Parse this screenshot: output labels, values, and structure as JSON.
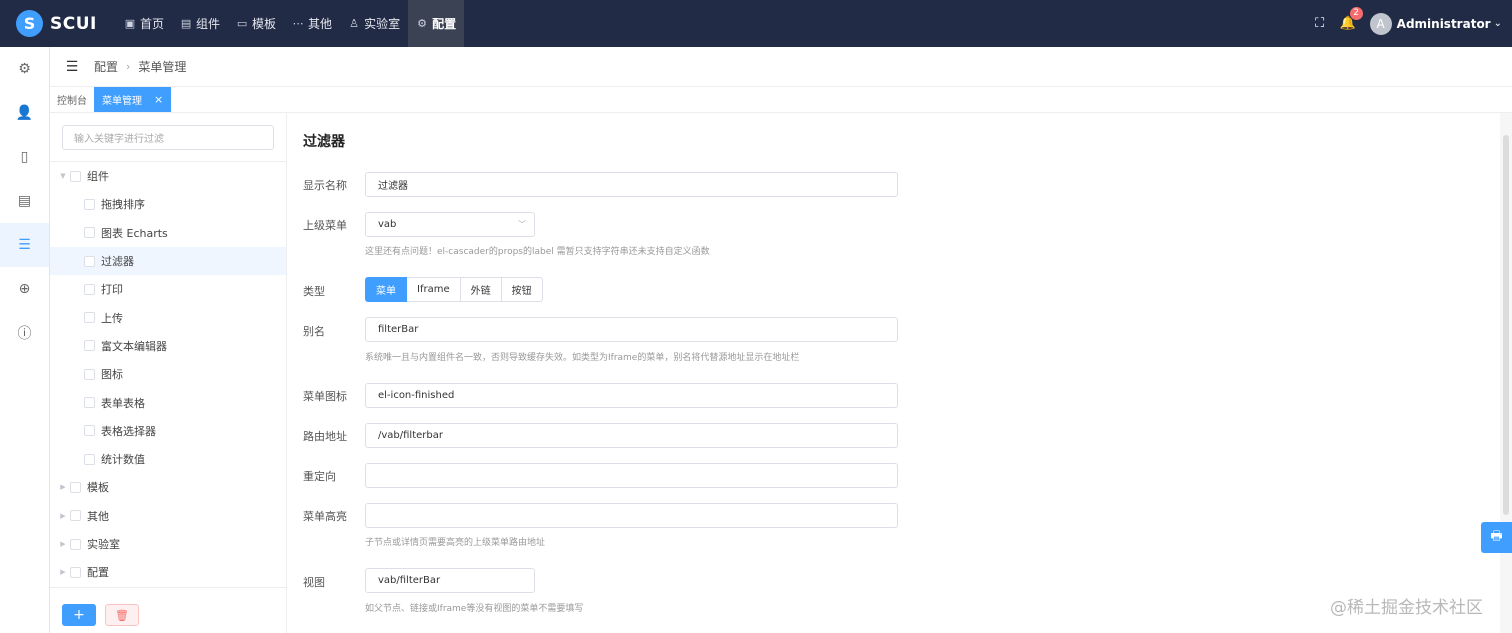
{
  "brand": {
    "name": "SCUI",
    "mark": "S"
  },
  "topnav": [
    {
      "label": "首页",
      "icon": "home-icon",
      "glyph": "▣"
    },
    {
      "label": "组件",
      "icon": "component-icon",
      "glyph": "▤"
    },
    {
      "label": "模板",
      "icon": "template-icon",
      "glyph": "▭"
    },
    {
      "label": "其他",
      "icon": "more-icon",
      "glyph": "⋯"
    },
    {
      "label": "实验室",
      "icon": "lab-icon",
      "glyph": "♙"
    },
    {
      "label": "配置",
      "icon": "settings-icon",
      "glyph": "⚙",
      "active": true
    }
  ],
  "user": {
    "avatar": "A",
    "name": "Administrator",
    "notifications": "2"
  },
  "rail": [
    {
      "icon": "gear-icon",
      "glyph": "⚙"
    },
    {
      "icon": "user-icon",
      "glyph": "👤"
    },
    {
      "icon": "book-icon",
      "glyph": "▯"
    },
    {
      "icon": "document-icon",
      "glyph": "▤"
    },
    {
      "icon": "menu-icon",
      "glyph": "☰",
      "active": true
    },
    {
      "icon": "circle-plus-icon",
      "glyph": "⊕"
    },
    {
      "icon": "info-icon",
      "glyph": "ⓘ"
    }
  ],
  "breadcrumb": {
    "parent": "配置",
    "current": "菜单管理"
  },
  "tags": {
    "home": "控制台",
    "active": "菜单管理"
  },
  "tree": {
    "search_placeholder": "输入关键字进行过滤",
    "nodes": [
      {
        "label": "组件",
        "level": 1,
        "expanded": true
      },
      {
        "label": "拖拽排序",
        "level": 2
      },
      {
        "label": "图表 Echarts",
        "level": 2
      },
      {
        "label": "过滤器",
        "level": 2,
        "selected": true
      },
      {
        "label": "打印",
        "level": 2
      },
      {
        "label": "上传",
        "level": 2
      },
      {
        "label": "富文本编辑器",
        "level": 2
      },
      {
        "label": "图标",
        "level": 2
      },
      {
        "label": "表单表格",
        "level": 2
      },
      {
        "label": "表格选择器",
        "level": 2
      },
      {
        "label": "统计数值",
        "level": 2
      },
      {
        "label": "模板",
        "level": 1,
        "expanded": false
      },
      {
        "label": "其他",
        "level": 1,
        "expanded": false
      },
      {
        "label": "实验室",
        "level": 1,
        "expanded": false
      },
      {
        "label": "配置",
        "level": 1,
        "expanded": false
      }
    ],
    "add_label": "+",
    "delete_label": "🗑"
  },
  "form": {
    "title": "过滤器",
    "display_name": {
      "label": "显示名称",
      "value": "过滤器"
    },
    "parent_menu": {
      "label": "上级菜单",
      "value": "vab",
      "hint": "这里还有点问题！el-cascader的props的label 需暂只支持字符串还未支持自定义函数"
    },
    "type": {
      "label": "类型",
      "options": [
        "菜单",
        "Iframe",
        "外链",
        "按钮"
      ],
      "selected": "菜单"
    },
    "alias": {
      "label": "别名",
      "value": "filterBar",
      "hint": "系统唯一且与内置组件名一致，否则导致缓存失效。如类型为Iframe的菜单，别名将代替源地址显示在地址栏"
    },
    "menu_icon": {
      "label": "菜单图标",
      "value": "el-icon-finished"
    },
    "route": {
      "label": "路由地址",
      "value": "/vab/filterbar"
    },
    "redirect": {
      "label": "重定向",
      "value": ""
    },
    "highlight": {
      "label": "菜单高亮",
      "value": "",
      "hint": "子节点或详情页需要高亮的上级菜单路由地址"
    },
    "view": {
      "label": "视图",
      "value": "vab/filterBar",
      "hint": "如父节点、链接或Iframe等没有视图的菜单不需要填写"
    }
  },
  "watermark": "@稀土掘金技术社区",
  "colors": {
    "topbar": "#222b45",
    "primary": "#409eff",
    "danger": "#f56c6c"
  }
}
